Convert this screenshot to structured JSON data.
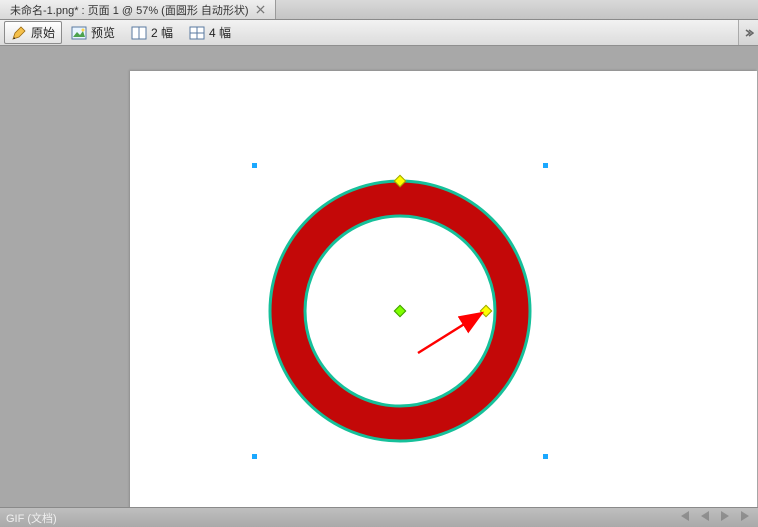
{
  "document_tab": {
    "title": "未命名-1.png* : 页面 1 @  57% (面圆形 自动形状)",
    "close_tooltip": "关闭"
  },
  "toolbar": {
    "items": [
      {
        "id": "original",
        "label": "原始",
        "icon": "pencil-icon",
        "active": true
      },
      {
        "id": "preview",
        "label": "预览",
        "icon": "picture-icon",
        "active": false
      },
      {
        "id": "2up",
        "label": "2 幅",
        "icon": "split2-icon",
        "active": false
      },
      {
        "id": "4up",
        "label": "4 幅",
        "icon": "split4-icon",
        "active": false
      }
    ]
  },
  "canvas_shape": {
    "type": "donut",
    "outer_fill": "#c30808",
    "stroke": "#16c09a",
    "stroke_width": 2,
    "outer_radius_ratio": 1.0,
    "inner_radius_ratio": 0.72
  },
  "status": {
    "text": "GIF (文档)"
  },
  "nav": {
    "first": "|◀",
    "prev": "◀",
    "next": "▶",
    "last": "▶|"
  }
}
